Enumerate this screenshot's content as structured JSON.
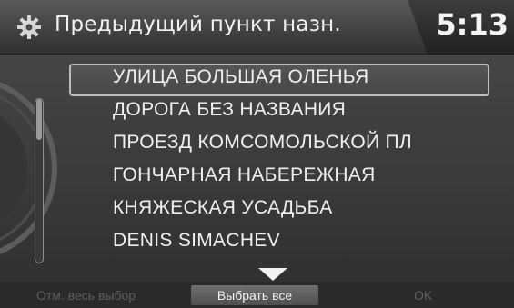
{
  "header": {
    "title": "Предыдущий пункт назн.",
    "clock": "5:13",
    "icon": "gear-icon"
  },
  "list": {
    "items": [
      {
        "label": "УЛИЦА БОЛЬШАЯ ОЛЕНЬЯ",
        "selected": true
      },
      {
        "label": "ДОРОГА БЕЗ НАЗВАНИЯ",
        "selected": false
      },
      {
        "label": "ПРОЕЗД КОМСОМОЛЬСКОЙ ПЛ",
        "selected": false
      },
      {
        "label": "ГОНЧАРНАЯ НАБЕРЕЖНАЯ",
        "selected": false
      },
      {
        "label": "КНЯЖЕСКАЯ УСАДЬБА",
        "selected": false
      },
      {
        "label": "DENIS SIMACHEV",
        "selected": false
      }
    ],
    "scroll_position": 0.0
  },
  "footer": {
    "deselect_all": "Отм. весь выбор",
    "select_all": "Выбрать все",
    "ok": "OK"
  },
  "colors": {
    "background": "#3b3b3b",
    "text": "#f0f0f0",
    "disabled_text": "#5e5e5e"
  }
}
